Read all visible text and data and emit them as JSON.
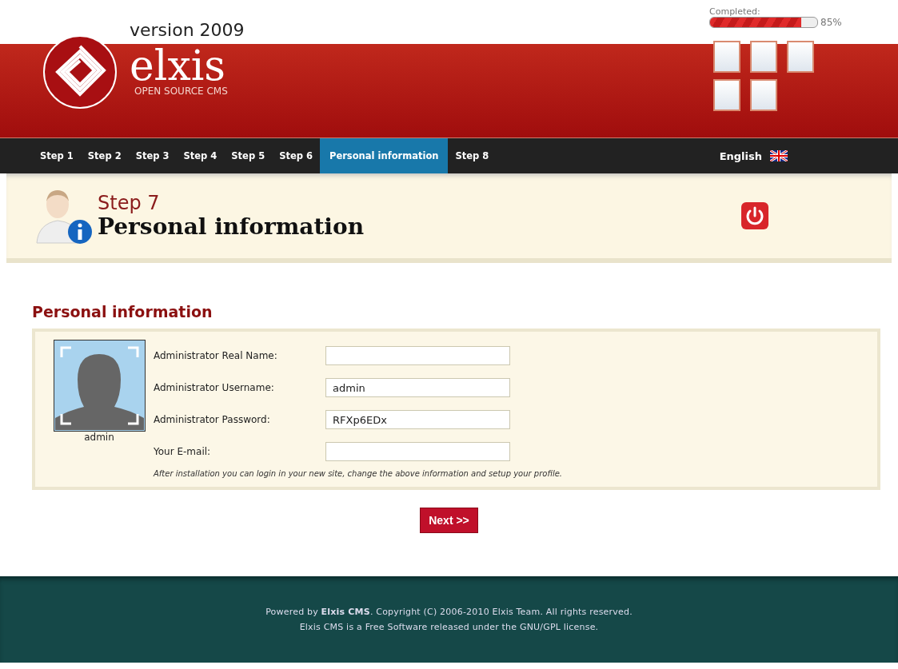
{
  "header": {
    "version": "version 2009",
    "logo_name": "elxis",
    "logo_tagline": "OPEN SOURCE CMS",
    "progress": {
      "label": "Completed:",
      "level": 0.85,
      "reading": "85%"
    }
  },
  "nav": {
    "tabs": [
      {
        "label": "Step 1",
        "selected": false
      },
      {
        "label": "Step 2",
        "selected": false
      },
      {
        "label": "Step 3",
        "selected": false
      },
      {
        "label": "Step 4",
        "selected": false
      },
      {
        "label": "Step 5",
        "selected": false
      },
      {
        "label": "Step 6",
        "selected": false
      },
      {
        "label": "Personal information",
        "selected": true
      },
      {
        "label": "Step 8",
        "selected": false
      }
    ],
    "language": "English"
  },
  "banner": {
    "step": "Step 7",
    "title": "Personal information"
  },
  "form": {
    "title": "Personal information",
    "avatar_caption": "admin",
    "fields": [
      {
        "label": "Administrator Real Name:"
      },
      {
        "label": "Administrator Username:",
        "value": "admin"
      },
      {
        "label": "Administrator Password:",
        "value": "RFXp6EDx"
      },
      {
        "label": "Your E-mail:"
      }
    ],
    "note": "After installation you can login in your new site, change the above information and setup your profile."
  },
  "next_button": "Next >>",
  "footer": {
    "line1": "Powered by **Elxis CMS**. Copyright (C) 2006-2010 Elxis Team. All rights reserved.",
    "line2": "Elxis CMS is a Free Software released under the GNU/GPL license."
  }
}
